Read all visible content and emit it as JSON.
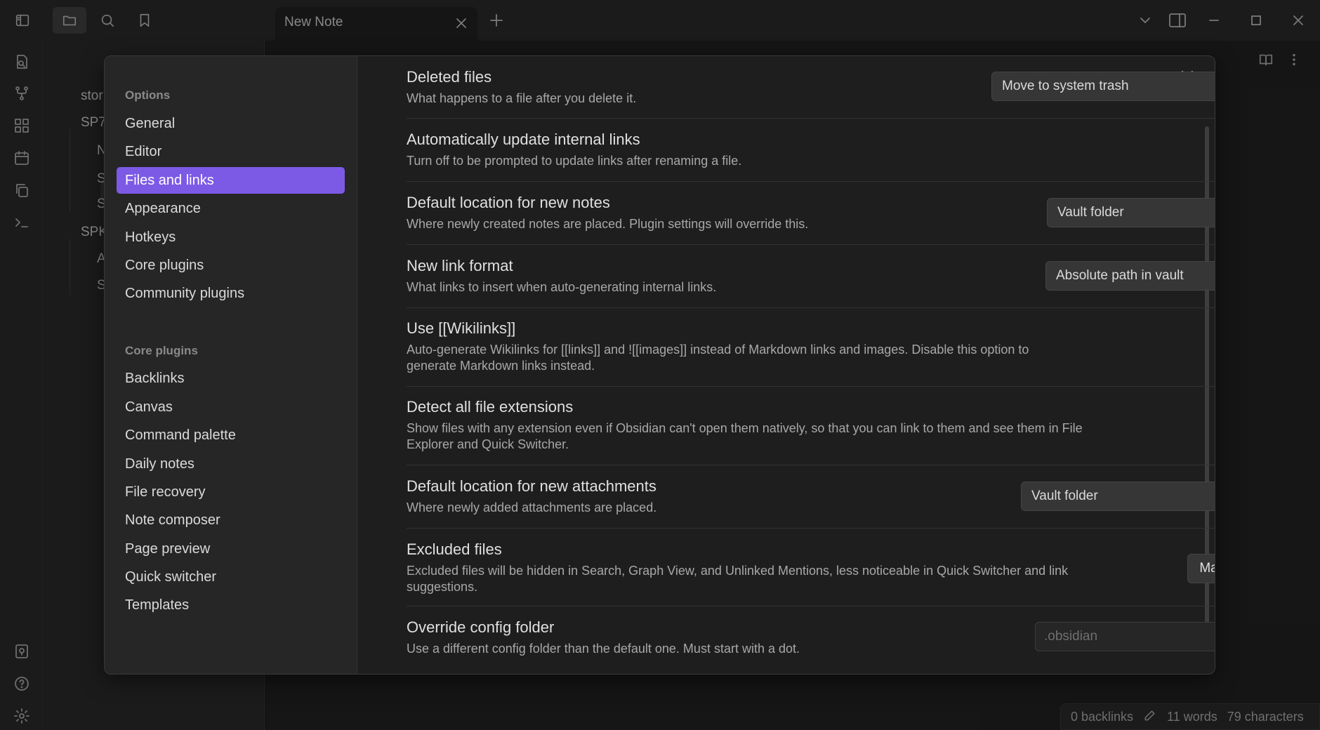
{
  "tab": {
    "title": "New Note"
  },
  "file_panel": {
    "items": [
      "stor",
      "SP7",
      "N",
      "S",
      "S",
      "SPK",
      "A",
      "S"
    ]
  },
  "status_bar": {
    "backlinks": "0 backlinks",
    "words": "11 words",
    "characters": "79 characters"
  },
  "settings": {
    "nav": {
      "options_heading": "Options",
      "options": [
        "General",
        "Editor",
        "Files and links",
        "Appearance",
        "Hotkeys",
        "Core plugins",
        "Community plugins"
      ],
      "active_item": "Files and links",
      "core_plugins_heading": "Core plugins",
      "core_plugins": [
        "Backlinks",
        "Canvas",
        "Command palette",
        "Daily notes",
        "File recovery",
        "Note composer",
        "Page preview",
        "Quick switcher",
        "Templates"
      ]
    },
    "rows": [
      {
        "name": "Deleted files",
        "desc": "What happens to a file after you delete it.",
        "control": "dropdown",
        "value": "Move to system trash"
      },
      {
        "name": "Automatically update internal links",
        "desc": "Turn off to be prompted to update links after renaming a file.",
        "control": "toggle",
        "value": "off"
      },
      {
        "name": "Default location for new notes",
        "desc": "Where newly created notes are placed. Plugin settings will override this.",
        "control": "dropdown",
        "value": "Vault folder"
      },
      {
        "name": "New link format",
        "desc": "What links to insert when auto-generating internal links.",
        "control": "dropdown",
        "value": "Absolute path in vault"
      },
      {
        "name": "Use [[Wikilinks]]",
        "desc": "Auto-generate Wikilinks for [[links]] and ![[images]] instead of Markdown links and images. Disable this option to generate Markdown links instead.",
        "control": "toggle",
        "value": "off"
      },
      {
        "name": "Detect all file extensions",
        "desc": "Show files with any extension even if Obsidian can't open them natively, so that you can link to them and see them in File Explorer and Quick Switcher.",
        "control": "toggle",
        "value": "off"
      },
      {
        "name": "Default location for new attachments",
        "desc": "Where newly added attachments are placed.",
        "control": "dropdown",
        "value": "Vault folder"
      },
      {
        "name": "Excluded files",
        "desc": "Excluded files will be hidden in Search, Graph View, and Unlinked Mentions, less noticeable in Quick Switcher and link suggestions.",
        "control": "button",
        "value": "Manage"
      },
      {
        "name": "Override config folder",
        "desc": "Use a different config folder than the default one. Must start with a dot.",
        "control": "input",
        "placeholder": ".obsidian"
      }
    ]
  },
  "colors": {
    "accent": "#7c5ae6",
    "background": "#1e1e1e",
    "panel": "#262626"
  }
}
